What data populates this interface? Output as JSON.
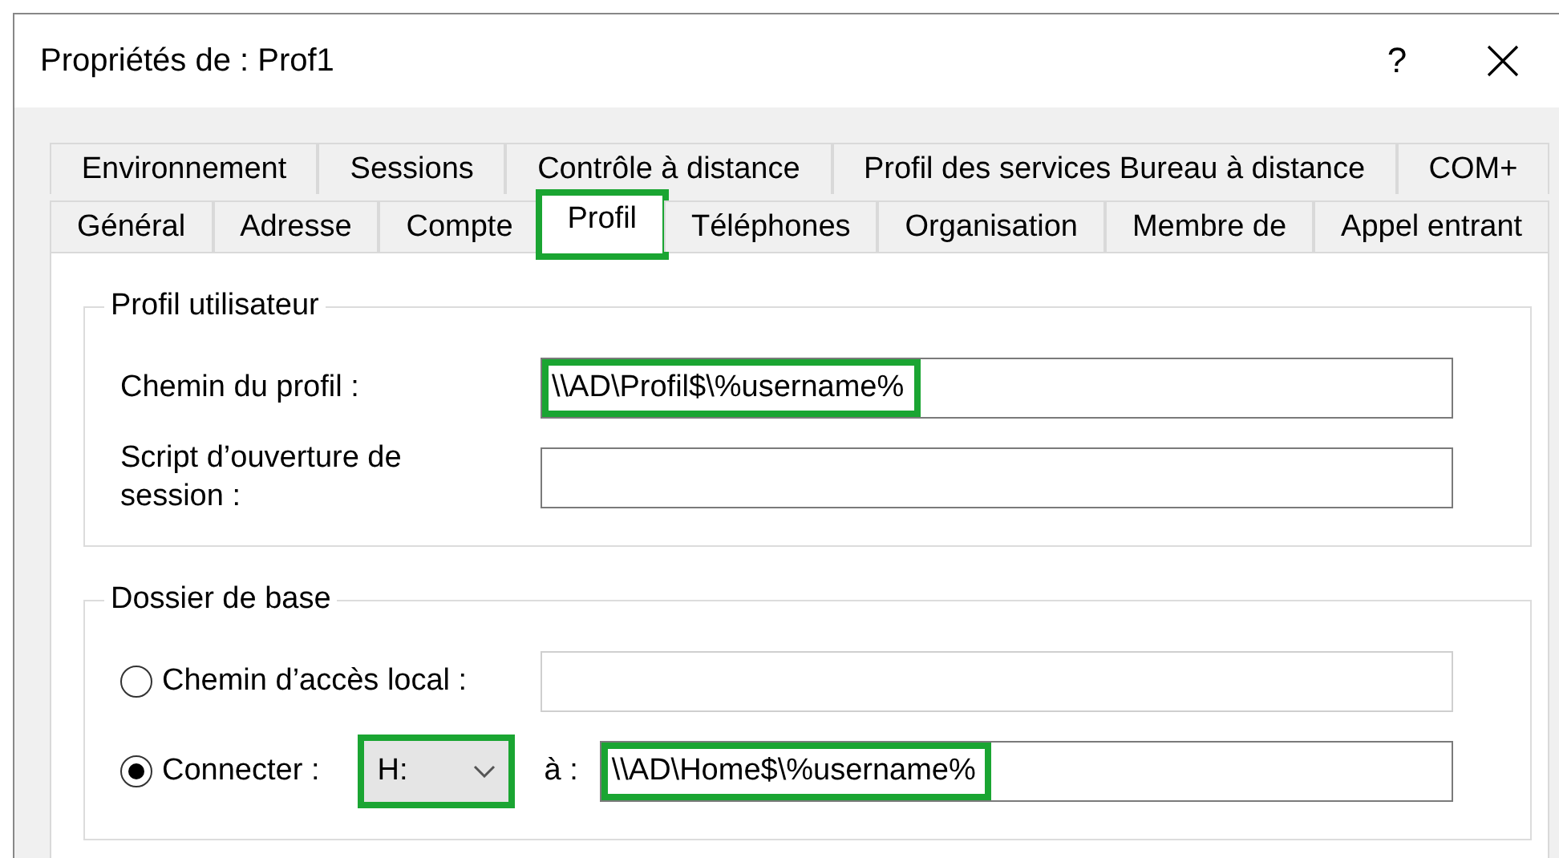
{
  "window": {
    "title": "Propriétés de : Prof1",
    "help": "?"
  },
  "tab_rows": [
    [
      {
        "label": "Environnement",
        "selected": false,
        "highlighted": false
      },
      {
        "label": "Sessions",
        "selected": false,
        "highlighted": false
      },
      {
        "label": "Contrôle à distance",
        "selected": false,
        "highlighted": false
      },
      {
        "label": "Profil des services Bureau à distance",
        "selected": false,
        "highlighted": false
      },
      {
        "label": "COM+",
        "selected": false,
        "highlighted": false
      }
    ],
    [
      {
        "label": "Général",
        "selected": false,
        "highlighted": false
      },
      {
        "label": "Adresse",
        "selected": false,
        "highlighted": false
      },
      {
        "label": "Compte",
        "selected": false,
        "highlighted": false
      },
      {
        "label": "Profil",
        "selected": true,
        "highlighted": true
      },
      {
        "label": "Téléphones",
        "selected": false,
        "highlighted": false
      },
      {
        "label": "Organisation",
        "selected": false,
        "highlighted": false
      },
      {
        "label": "Membre de",
        "selected": false,
        "highlighted": false
      },
      {
        "label": "Appel entrant",
        "selected": false,
        "highlighted": false
      }
    ]
  ],
  "profile_group": {
    "title": "Profil utilisateur",
    "fields": [
      {
        "label": "Chemin du profil :",
        "value": "\\\\AD\\Profil$\\%username%",
        "highlighted": true
      },
      {
        "label": "Script d’ouverture de session :",
        "highlighted": false
      }
    ]
  },
  "home_group": {
    "title": "Dossier de base",
    "options": [
      {
        "kind": "local",
        "label": "Chemin d’accès local :",
        "selected": false
      },
      {
        "kind": "connect",
        "label": "Connecter :",
        "selected": true,
        "drive": "H:",
        "drive_highlighted": true,
        "to_label": "à :",
        "value": "\\\\AD\\Home$\\%username%",
        "highlighted": true
      }
    ]
  }
}
